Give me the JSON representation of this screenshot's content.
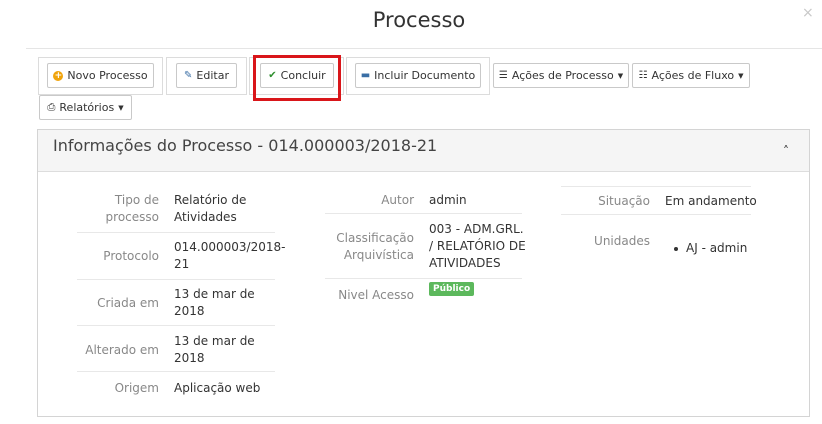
{
  "modal": {
    "title": "Processo",
    "close": "×"
  },
  "toolbar": {
    "novo_processo": "Novo Processo",
    "editar": "Editar",
    "concluir": "Concluir",
    "incluir_documento": "Incluir Documento",
    "acoes_processo": "Ações de Processo",
    "acoes_fluxo": "Ações de Fluxo",
    "relatorios": "Relatórios"
  },
  "panel": {
    "title": "Informações do Processo - 014.000003/2018-21"
  },
  "info": {
    "tipo_label": [
      "Tipo de",
      "processo"
    ],
    "tipo_value": [
      "Relatório de",
      "Atividades"
    ],
    "protocolo_label": "Protocolo",
    "protocolo_value": [
      "014.000003/2018-",
      "21"
    ],
    "criada_label": "Criada em",
    "criada_value": [
      "13 de mar de",
      "2018"
    ],
    "alterado_label": "Alterado em",
    "alterado_value": [
      "13 de mar de",
      "2018"
    ],
    "origem_label": "Origem",
    "origem_value": "Aplicação web",
    "autor_label": "Autor",
    "autor_value": "admin",
    "classificacao_label": [
      "Classificação",
      "Arquivística"
    ],
    "classificacao_value": [
      "003 - ADM.GRL.",
      "/ RELATÓRIO DE",
      "ATIVIDADES"
    ],
    "nivel_label": "Nivel Acesso",
    "nivel_value": "Público",
    "situacao_label": "Situação",
    "situacao_value": "Em andamento",
    "unidades_label": "Unidades",
    "unidades_items": [
      "AJ - admin"
    ]
  },
  "colors": {
    "highlight": "#d9161a",
    "badge": "#5cb85c",
    "check": "#2f8f2f",
    "plus": "#f0a30a"
  }
}
